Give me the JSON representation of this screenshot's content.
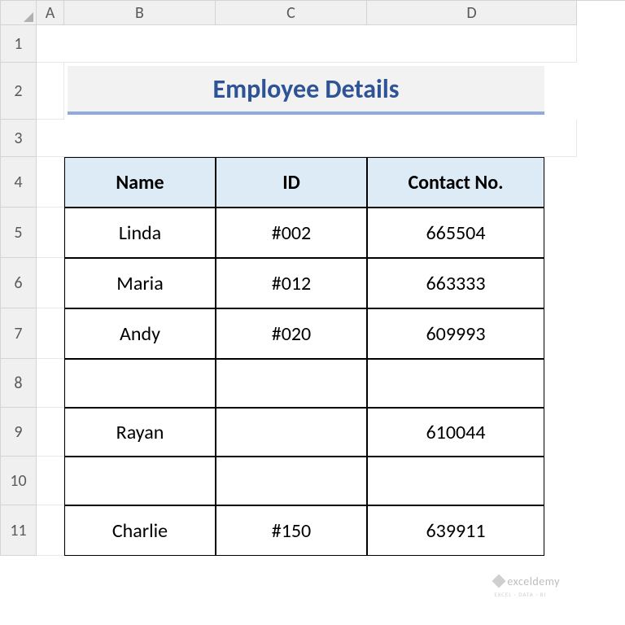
{
  "columns": [
    "A",
    "B",
    "C",
    "D"
  ],
  "rows": [
    "1",
    "2",
    "3",
    "4",
    "5",
    "6",
    "7",
    "8",
    "9",
    "10",
    "11"
  ],
  "title": "Employee Details",
  "headers": {
    "name": "Name",
    "id": "ID",
    "contact": "Contact No."
  },
  "data": [
    {
      "name": "Linda",
      "id": "#002",
      "contact": "665504"
    },
    {
      "name": "Maria",
      "id": "#012",
      "contact": "663333"
    },
    {
      "name": "Andy",
      "id": "#020",
      "contact": "609993"
    },
    {
      "name": "",
      "id": "",
      "contact": ""
    },
    {
      "name": "Rayan",
      "id": "",
      "contact": "610044"
    },
    {
      "name": "",
      "id": "",
      "contact": ""
    },
    {
      "name": "Charlie",
      "id": "#150",
      "contact": "639911"
    }
  ],
  "watermark": {
    "brand": "exceldemy",
    "tag": "EXCEL · DATA · BI"
  }
}
